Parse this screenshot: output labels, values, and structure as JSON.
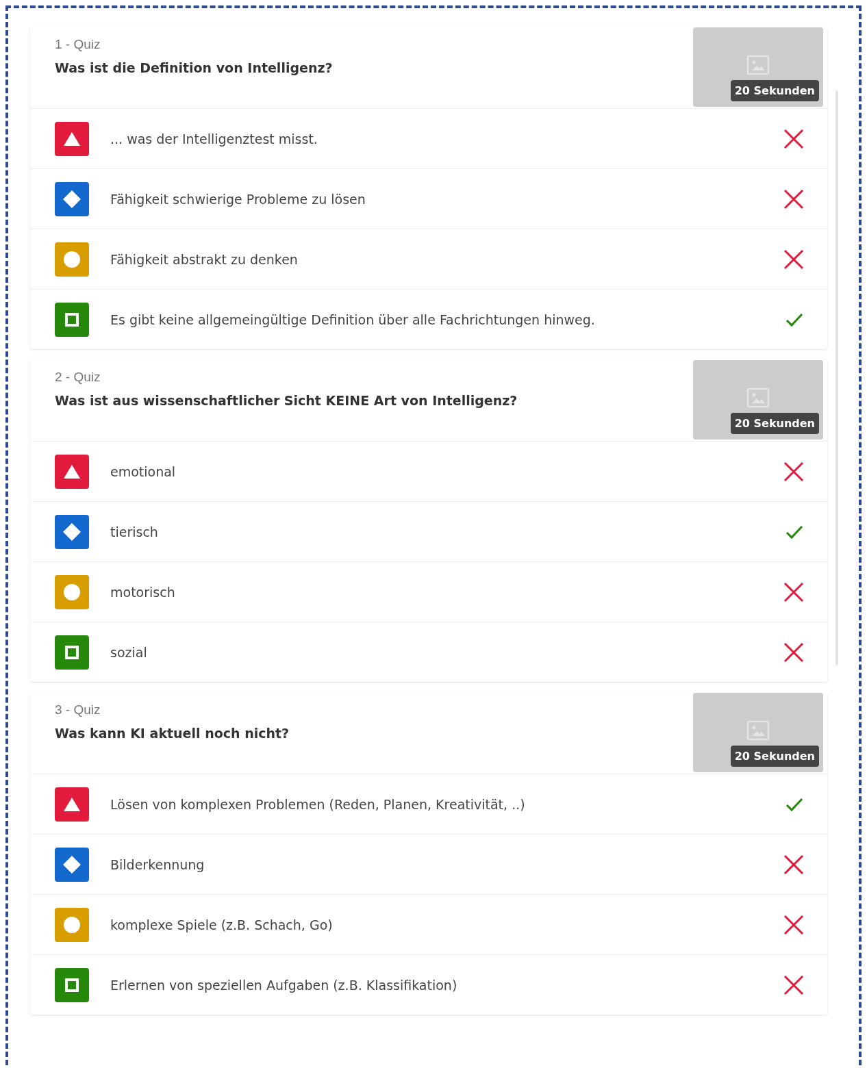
{
  "quizzes": [
    {
      "label": "1 - Quiz",
      "question": "Was ist die Definition von Intelligenz?",
      "time": "20 Sekunden",
      "answers": [
        {
          "kind": "triangle",
          "text": "... was der Intelligenztest misst.",
          "correct": false
        },
        {
          "kind": "diamond",
          "text": "Fähigkeit schwierige Probleme zu lösen",
          "correct": false
        },
        {
          "kind": "circle",
          "text": "Fähigkeit abstrakt zu denken",
          "correct": false
        },
        {
          "kind": "square",
          "text": "Es gibt keine allgemeingültige Definition über alle Fachrichtungen hinweg.",
          "correct": true
        }
      ]
    },
    {
      "label": "2 - Quiz",
      "question": "Was ist aus wissenschaftlicher Sicht KEINE Art von Intelligenz?",
      "time": "20 Sekunden",
      "answers": [
        {
          "kind": "triangle",
          "text": "emotional",
          "correct": false
        },
        {
          "kind": "diamond",
          "text": "tierisch",
          "correct": true
        },
        {
          "kind": "circle",
          "text": "motorisch",
          "correct": false
        },
        {
          "kind": "square",
          "text": "sozial",
          "correct": false
        }
      ]
    },
    {
      "label": "3 - Quiz",
      "question": "Was kann KI aktuell noch nicht?",
      "time": "20 Sekunden",
      "answers": [
        {
          "kind": "triangle",
          "text": "Lösen von komplexen Problemen (Reden, Planen, Kreativität, ..)",
          "correct": true
        },
        {
          "kind": "diamond",
          "text": "Bilderkennung",
          "correct": false
        },
        {
          "kind": "circle",
          "text": "komplexe Spiele (z.B. Schach, Go)",
          "correct": false
        },
        {
          "kind": "square",
          "text": "Erlernen von speziellen Aufgaben (z.B. Klassifikation)",
          "correct": false
        }
      ]
    }
  ]
}
